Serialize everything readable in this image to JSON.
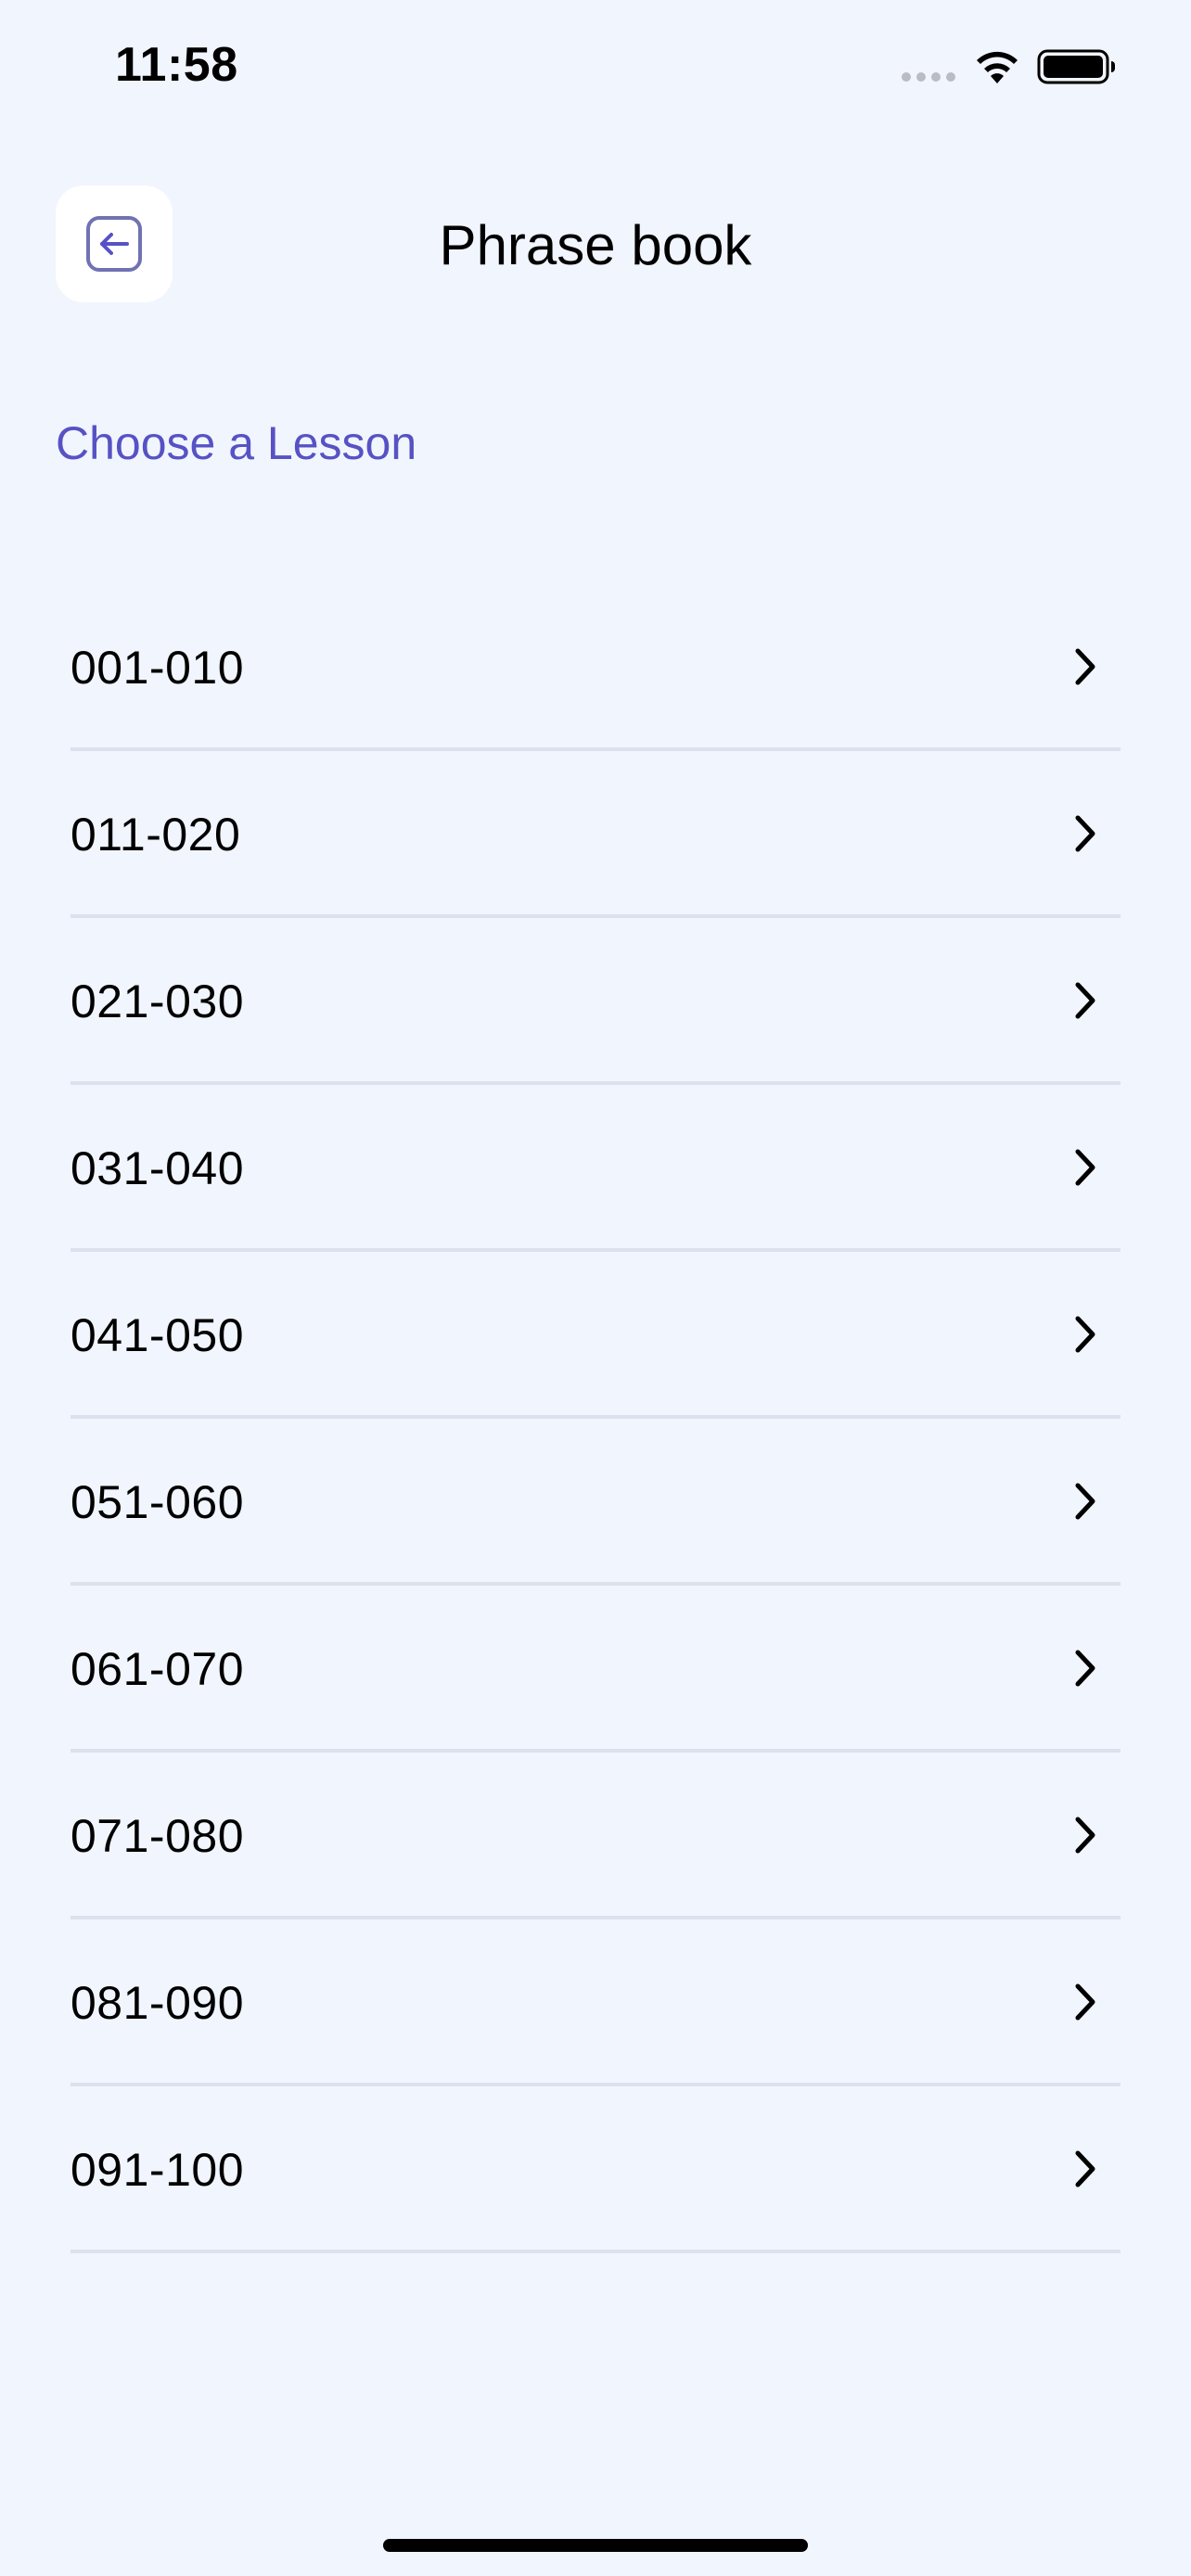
{
  "status_bar": {
    "time": "11:58"
  },
  "header": {
    "title": "Phrase book",
    "back_icon": "back-arrow-icon"
  },
  "section_heading": "Choose a Lesson",
  "lessons": [
    {
      "label": "001-010"
    },
    {
      "label": "011-020"
    },
    {
      "label": "021-030"
    },
    {
      "label": "031-040"
    },
    {
      "label": "041-050"
    },
    {
      "label": "051-060"
    },
    {
      "label": "061-070"
    },
    {
      "label": "071-080"
    },
    {
      "label": "081-090"
    },
    {
      "label": "091-100"
    }
  ],
  "colors": {
    "background": "#f1f5fd",
    "accent": "#5752c4",
    "divider": "#dde1ee",
    "back_icon": "#7072b3"
  }
}
